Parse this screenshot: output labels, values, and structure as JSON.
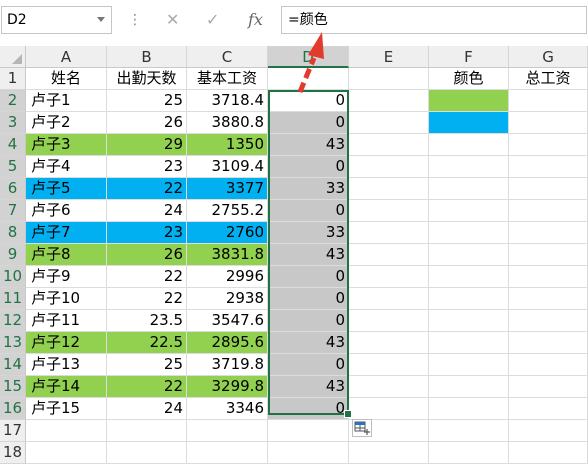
{
  "formula_bar": {
    "name_box": "D2",
    "separator": "⋮",
    "cancel_icon": "✕",
    "enter_icon": "✓",
    "fx_label": "fx",
    "formula": "=颜色"
  },
  "columns": [
    "A",
    "B",
    "C",
    "D",
    "E",
    "F",
    "G"
  ],
  "rows": [
    "1",
    "2",
    "3",
    "4",
    "5",
    "6",
    "7",
    "8",
    "9",
    "10",
    "11",
    "12",
    "13",
    "14",
    "15",
    "16",
    "17",
    "18"
  ],
  "headers": {
    "a1": "姓名",
    "b1": "出勤天数",
    "c1": "基本工资",
    "f1": "颜色",
    "g1": "总工资"
  },
  "records": [
    {
      "name": "卢子1",
      "days": "25",
      "salary": "3718.4",
      "color_code": "0",
      "fill": "none"
    },
    {
      "name": "卢子2",
      "days": "26",
      "salary": "3880.8",
      "color_code": "0",
      "fill": "none"
    },
    {
      "name": "卢子3",
      "days": "29",
      "salary": "1350",
      "color_code": "43",
      "fill": "green"
    },
    {
      "name": "卢子4",
      "days": "23",
      "salary": "3109.4",
      "color_code": "0",
      "fill": "none"
    },
    {
      "name": "卢子5",
      "days": "22",
      "salary": "3377",
      "color_code": "33",
      "fill": "blue"
    },
    {
      "name": "卢子6",
      "days": "24",
      "salary": "2755.2",
      "color_code": "0",
      "fill": "none"
    },
    {
      "name": "卢子7",
      "days": "23",
      "salary": "2760",
      "color_code": "33",
      "fill": "blue"
    },
    {
      "name": "卢子8",
      "days": "26",
      "salary": "3831.8",
      "color_code": "43",
      "fill": "green"
    },
    {
      "name": "卢子9",
      "days": "22",
      "salary": "2996",
      "color_code": "0",
      "fill": "none"
    },
    {
      "name": "卢子10",
      "days": "22",
      "salary": "2938",
      "color_code": "0",
      "fill": "none"
    },
    {
      "name": "卢子11",
      "days": "23.5",
      "salary": "3547.6",
      "color_code": "0",
      "fill": "none"
    },
    {
      "name": "卢子12",
      "days": "22.5",
      "salary": "2895.6",
      "color_code": "43",
      "fill": "green"
    },
    {
      "name": "卢子13",
      "days": "25",
      "salary": "3719.8",
      "color_code": "0",
      "fill": "none"
    },
    {
      "name": "卢子14",
      "days": "22",
      "salary": "3299.8",
      "color_code": "43",
      "fill": "green"
    },
    {
      "name": "卢子15",
      "days": "24",
      "salary": "3346",
      "color_code": "0",
      "fill": "none"
    }
  ],
  "legend_fills": [
    "green",
    "blue"
  ],
  "colors": {
    "green": "#92d050",
    "blue": "#00b0f0",
    "selection": "#217346",
    "arrow": "#e23b2e"
  },
  "icons": {
    "name_box_dropdown": "chevron-down-icon",
    "cancel": "close-icon",
    "enter": "check-icon",
    "fx": "function-icon",
    "quick_analysis": "quick-analysis-icon",
    "annotation": "red-dashed-arrow"
  }
}
